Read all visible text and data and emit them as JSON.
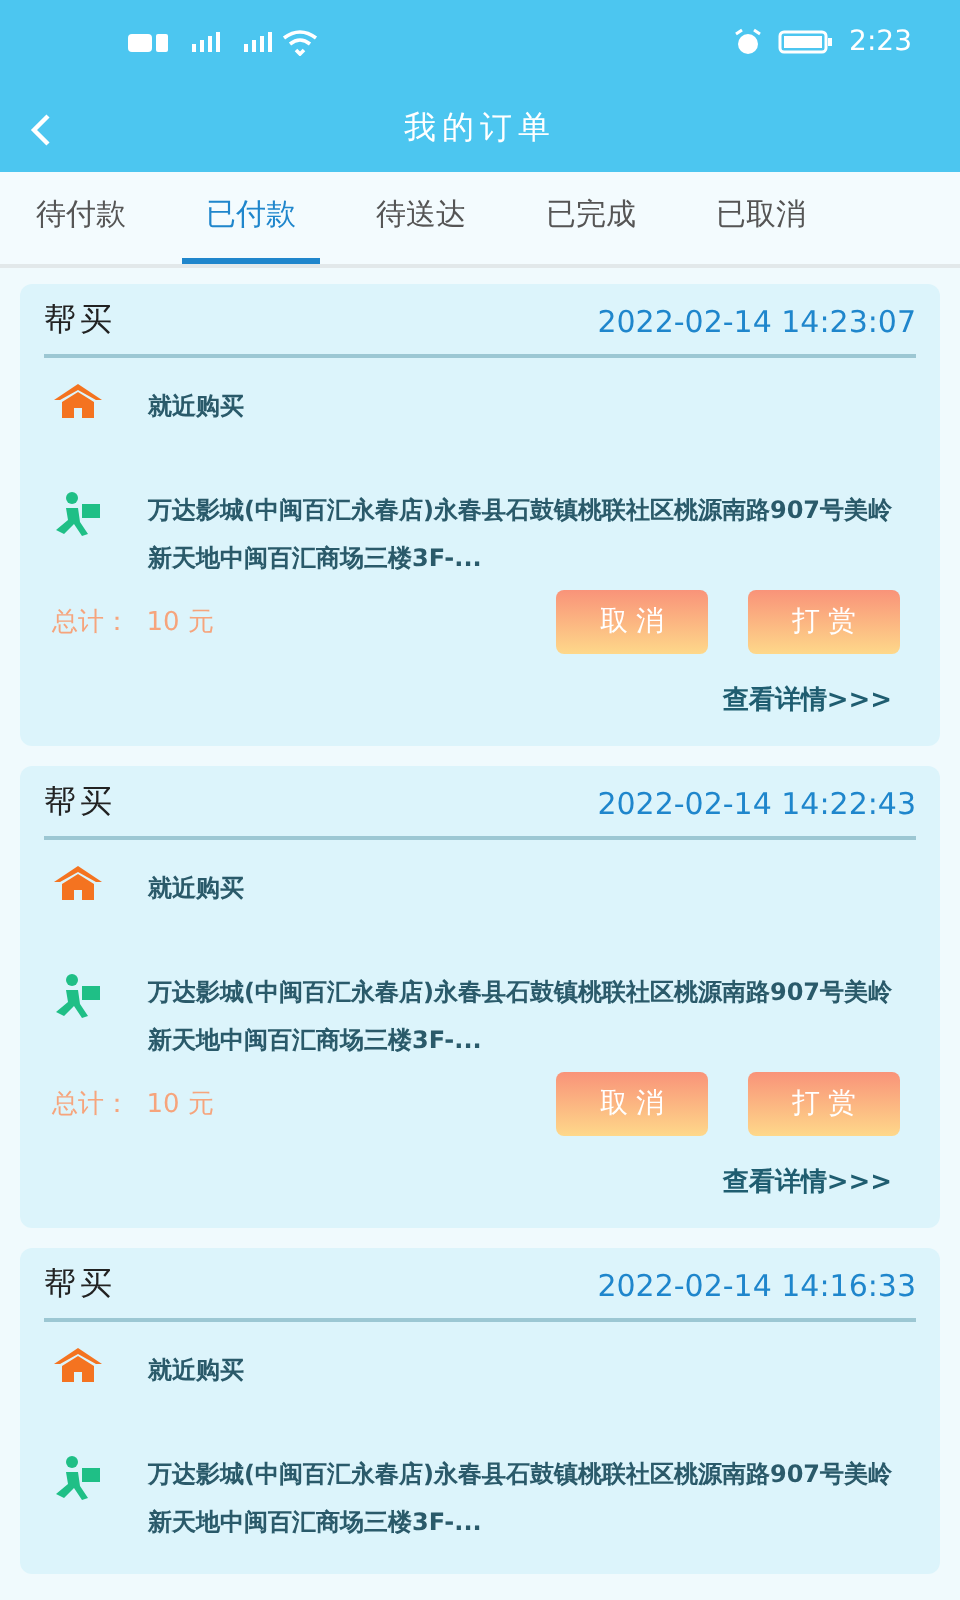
{
  "status_bar": {
    "time": "2:23"
  },
  "header": {
    "title": "我的订单"
  },
  "tabs": [
    {
      "label": "待付款",
      "selected": false
    },
    {
      "label": "已付款",
      "selected": true
    },
    {
      "label": "待送达",
      "selected": false
    },
    {
      "label": "已完成",
      "selected": false
    },
    {
      "label": "已取消",
      "selected": false
    }
  ],
  "orders": [
    {
      "type": "帮买",
      "time": "2022-02-14 14:23:07",
      "shop": "就近购买",
      "address": "万达影城(中闽百汇永春店)永春县石鼓镇桃联社区桃源南路907号美岭新天地中闽百汇商场三楼3F-...",
      "total": "总计：  10 元",
      "buttons": [
        "取 消",
        "打 赏"
      ],
      "details": "查看详情>>>"
    },
    {
      "type": "帮买",
      "time": "2022-02-14 14:22:43",
      "shop": "就近购买",
      "address": "万达影城(中闽百汇永春店)永春县石鼓镇桃联社区桃源南路907号美岭新天地中闽百汇商场三楼3F-...",
      "total": "总计：  10 元",
      "buttons": [
        "取 消",
        "打 赏"
      ],
      "details": "查看详情>>>"
    },
    {
      "type": "帮买",
      "time": "2022-02-14 14:16:33",
      "shop": "就近购买",
      "address": "万达影城(中闽百汇永春店)永春县石鼓镇桃联社区桃源南路907号美岭新天地中闽百汇商场三楼3F-..."
    }
  ]
}
